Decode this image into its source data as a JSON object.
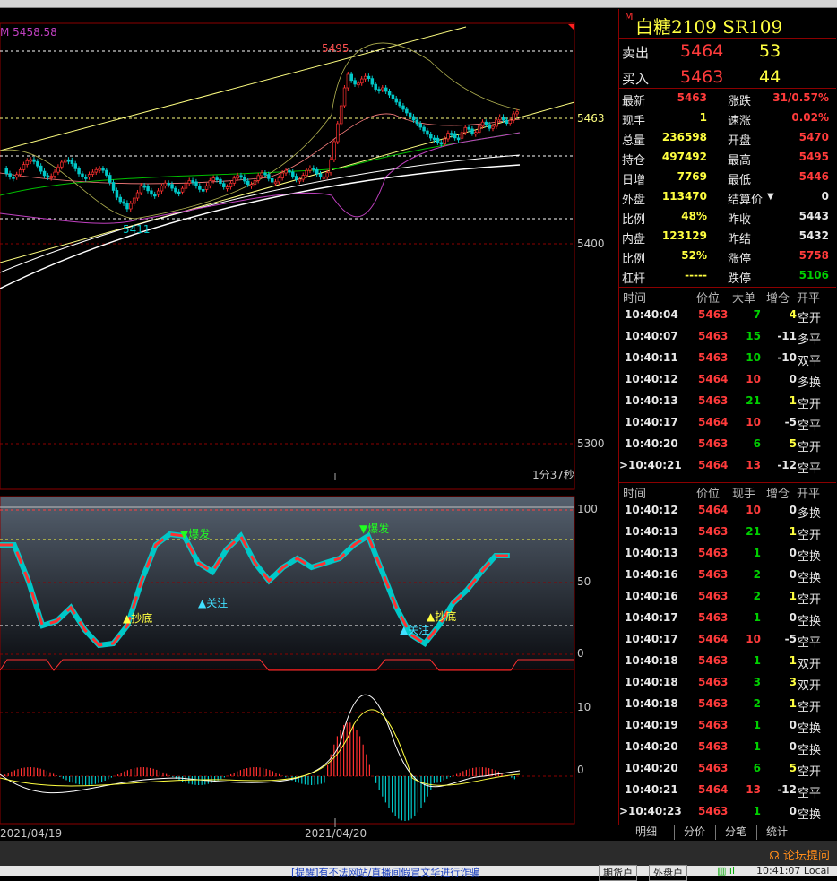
{
  "chart": {
    "ma_label": "M 5458.58",
    "price_axis": [
      "5463",
      "5400",
      "5300"
    ],
    "high_label": "5495",
    "low_label": "5411",
    "timer": "1分37秒",
    "indicator_axis": [
      "100",
      "50",
      "0"
    ],
    "macd_axis": [
      "10",
      "0"
    ],
    "signals": [
      "爆发",
      "抄底",
      "关注",
      "爆发",
      "抄底",
      "关注"
    ],
    "dates": [
      "2021/04/19",
      "2021/04/20"
    ],
    "colors": {
      "up": "#ff3030",
      "down": "#00c8c8",
      "grid": "#8b0000",
      "yellow": "#ffff40",
      "white": "#ffffff",
      "magenta": "#c040c0"
    }
  },
  "quote": {
    "marker": "M",
    "title": "白糖2109  SR109",
    "sell": {
      "label": "卖出",
      "price": "5464",
      "vol": "53"
    },
    "buy": {
      "label": "买入",
      "price": "5463",
      "vol": "44"
    },
    "stats_left": [
      {
        "k": "最新",
        "v": "5463"
      },
      {
        "k": "现手",
        "v": "1"
      },
      {
        "k": "总量",
        "v": "236598"
      },
      {
        "k": "持仓",
        "v": "497492"
      },
      {
        "k": "日增",
        "v": "7769"
      },
      {
        "k": "外盘",
        "v": "113470"
      },
      {
        "k": "比例",
        "v": "48%"
      },
      {
        "k": "内盘",
        "v": "123129"
      },
      {
        "k": "比例",
        "v": "52%"
      },
      {
        "k": "杠杆",
        "v": "-----"
      }
    ],
    "stats_right": [
      {
        "k": "涨跌",
        "v": "31/0.57%"
      },
      {
        "k": "速涨",
        "v": "0.02%"
      },
      {
        "k": "开盘",
        "v": "5470"
      },
      {
        "k": "最高",
        "v": "5495"
      },
      {
        "k": "最低",
        "v": "5446"
      },
      {
        "k": "结算价",
        "v": "0"
      },
      {
        "k": "昨收",
        "v": "5443"
      },
      {
        "k": "昨结",
        "v": "5432"
      },
      {
        "k": "涨停",
        "v": "5758"
      },
      {
        "k": "跌停",
        "v": "5106"
      }
    ],
    "big_header": [
      "时间",
      "价位",
      "大单",
      "增仓",
      "开平"
    ],
    "big_trades": [
      [
        "10:40:04",
        "5463",
        "7",
        "4",
        "空开"
      ],
      [
        "10:40:07",
        "5463",
        "15",
        "-11",
        "多平"
      ],
      [
        "10:40:11",
        "5463",
        "10",
        "-10",
        "双平"
      ],
      [
        "10:40:12",
        "5464",
        "10",
        "0",
        "多换"
      ],
      [
        "10:40:13",
        "5463",
        "21",
        "1",
        "空开"
      ],
      [
        "10:40:17",
        "5464",
        "10",
        "-5",
        "空平"
      ],
      [
        "10:40:20",
        "5463",
        "6",
        "5",
        "空开"
      ],
      [
        ">10:40:21",
        "5464",
        "13",
        "-12",
        "空平"
      ]
    ],
    "tick_header": [
      "时间",
      "价位",
      "现手",
      "增仓",
      "开平"
    ],
    "ticks": [
      [
        "10:40:12",
        "5464",
        "10",
        "0",
        "多换"
      ],
      [
        "10:40:13",
        "5463",
        "21",
        "1",
        "空开"
      ],
      [
        "10:40:13",
        "5463",
        "1",
        "0",
        "空换"
      ],
      [
        "10:40:16",
        "5463",
        "2",
        "0",
        "空换"
      ],
      [
        "10:40:16",
        "5463",
        "2",
        "1",
        "空开"
      ],
      [
        "10:40:17",
        "5463",
        "1",
        "0",
        "空换"
      ],
      [
        "10:40:17",
        "5464",
        "10",
        "-5",
        "空平"
      ],
      [
        "10:40:18",
        "5463",
        "1",
        "1",
        "双开"
      ],
      [
        "10:40:18",
        "5463",
        "3",
        "3",
        "双开"
      ],
      [
        "10:40:18",
        "5463",
        "2",
        "1",
        "空开"
      ],
      [
        "10:40:19",
        "5463",
        "1",
        "0",
        "空换"
      ],
      [
        "10:40:20",
        "5463",
        "1",
        "0",
        "空换"
      ],
      [
        "10:40:20",
        "5463",
        "6",
        "5",
        "空开"
      ],
      [
        "10:40:21",
        "5464",
        "13",
        "-12",
        "空平"
      ],
      [
        ">10:40:23",
        "5463",
        "1",
        "0",
        "空换"
      ]
    ],
    "tabs": [
      "明细",
      "分价",
      "分笔",
      "统计"
    ]
  },
  "status": {
    "forum": "论坛提问",
    "notice": "[提醒]有不法网站/直播间假冒文华进行诈骗",
    "btn1": "期货户",
    "btn2": "外盘户",
    "clock": "10:41:07 Local"
  }
}
